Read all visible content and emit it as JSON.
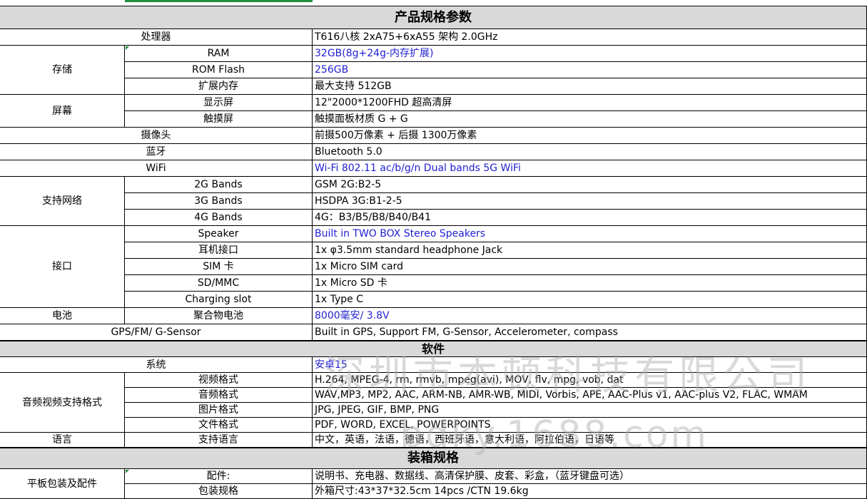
{
  "sections": {
    "specs_title": "产品规格参数",
    "software_title": "软件",
    "packing_title": "装箱规格"
  },
  "rows": {
    "cpu": {
      "label": "处理器",
      "value": "T616八核 2xA75+6xA55 架构   2.0GHz"
    },
    "storage": {
      "group": "存储",
      "ram": {
        "label": "RAM",
        "value": "32GB(8g+24g-内存扩展)"
      },
      "rom": {
        "label": "ROM Flash",
        "value": "256GB"
      },
      "ext": {
        "label": "扩展内存",
        "value": "最大支持 512GB"
      }
    },
    "screen": {
      "group": "屏幕",
      "display": {
        "label": "显示屏",
        "value": "12\"2000*1200FHD 超高清屏"
      },
      "touch": {
        "label": "触摸屏",
        "value": "触摸面板材质 G + G"
      }
    },
    "camera": {
      "label": "摄像头",
      "value": "前摄500万像素 + 后摄 1300万像素"
    },
    "bluetooth": {
      "label": "蓝牙",
      "value": "Bluetooth 5.0"
    },
    "wifi": {
      "label": "WiFi",
      "value": "Wi-Fi 802.11 ac/b/g/n  Dual bands 5G WiFi"
    },
    "network": {
      "group": "支持网络",
      "b2g": {
        "label": "2G Bands",
        "value": "GSM 2G:B2-5"
      },
      "b3g": {
        "label": "3G Bands",
        "value": "HSDPA 3G:B1-2-5"
      },
      "b4g": {
        "label": "4G Bands",
        "value": "4G：B3/B5/B8/B40/B41"
      }
    },
    "ports": {
      "group": "接口",
      "speaker": {
        "label": "Speaker",
        "value": "Built in TWO BOX Stereo Speakers"
      },
      "jack": {
        "label": "耳机接口",
        "value": "1x φ3.5mm standard headphone Jack"
      },
      "sim": {
        "label": "SIM 卡",
        "value": "1x Micro SIM card"
      },
      "sd": {
        "label": "SD/MMC",
        "value": "1x Micro SD 卡"
      },
      "charge": {
        "label": "Charging slot",
        "value": "1x Type C"
      }
    },
    "battery": {
      "group": "电池",
      "label": "聚合物电池",
      "value": " 8000毫安/ 3.8V"
    },
    "gps": {
      "label": "GPS/FM/ G-Sensor",
      "value": "Built in GPS, Support FM, G-Sensor, Accelerometer, compass"
    },
    "os": {
      "label": "系统",
      "value": "安卓15"
    },
    "media": {
      "group": "音频视频支持格式",
      "video": {
        "label": "视频格式",
        "value": "H.264, MPEG-4, rm, rmvb, mpeg(avi), MOV, flv, mpg, vob, dat"
      },
      "audio": {
        "label": "音频格式",
        "value": "WAV,MP3, MP2, AAC, ARM-NB, AMR-WB, MIDI, Vorbis, APE, AAC-Plus v1, AAC-plus V2, FLAC, WMAM"
      },
      "image": {
        "label": "图片格式",
        "value": "JPG, JPEG, GIF, BMP, PNG"
      },
      "doc": {
        "label": "文件格式",
        "value": "PDF, WORD, EXCEL, POWERPOINTS"
      }
    },
    "language": {
      "group": "语言",
      "label": "支持语言",
      "value": "中文，英语，法语，德语，西班牙语，意大利语，阿拉伯语，日语等"
    },
    "pack": {
      "group": "平板包装及配件",
      "acc": {
        "label": "配件:",
        "value": "说明书、充电器、数据线、高清保护膜、皮套、彩盒，（蓝牙键盘可选）"
      },
      "spec": {
        "label": "包装规格",
        "value": "外箱尺寸:43*37*32.5cm             14pcs /CTN                 19.6kg"
      }
    }
  },
  "watermark": {
    "line1": "深圳市本顿科技有限公司",
    "line2": "bdky.1688.com"
  },
  "colors": {
    "header_bg": "#d9d9d9",
    "blue_text": "#1f1fd1",
    "green_mark": "#1e8f3c"
  }
}
